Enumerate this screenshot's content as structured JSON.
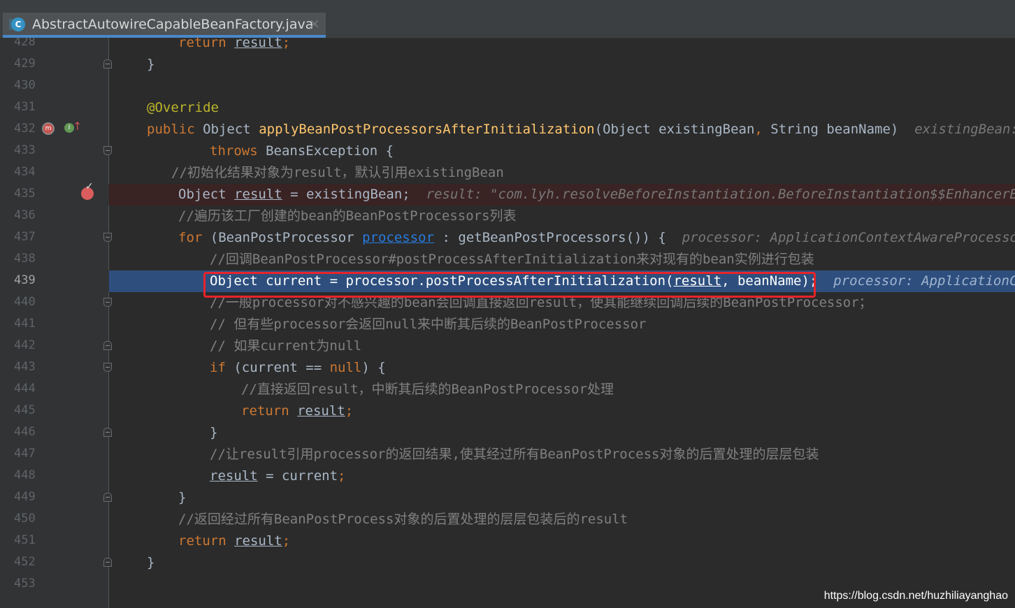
{
  "tab": {
    "icon_letter": "C",
    "title": "AbstractAutowireCapableBeanFactory.java",
    "close": "×"
  },
  "lines": {
    "428": {
      "num": "428"
    },
    "429": {
      "num": "429"
    },
    "430": {
      "num": "430"
    },
    "431": {
      "num": "431"
    },
    "432": {
      "num": "432"
    },
    "433": {
      "num": "433"
    },
    "434": {
      "num": "434"
    },
    "435": {
      "num": "435"
    },
    "436": {
      "num": "436"
    },
    "437": {
      "num": "437"
    },
    "438": {
      "num": "438"
    },
    "439": {
      "num": "439"
    },
    "440": {
      "num": "440"
    },
    "441": {
      "num": "441"
    },
    "442": {
      "num": "442"
    },
    "443": {
      "num": "443"
    },
    "444": {
      "num": "444"
    },
    "445": {
      "num": "445"
    },
    "446": {
      "num": "446"
    },
    "447": {
      "num": "447"
    },
    "448": {
      "num": "448"
    },
    "449": {
      "num": "449"
    },
    "450": {
      "num": "450"
    },
    "451": {
      "num": "451"
    },
    "452": {
      "num": "452"
    },
    "453": {
      "num": "453"
    }
  },
  "code": {
    "return_kw": "return",
    "result": "result",
    "semi": ";",
    "close_brace": "}",
    "annotation": "@Override",
    "public_kw": "public",
    "object_type": "Object",
    "method_name": "applyBeanPostProcessorsAfterInitialization",
    "params_1": "(Object existingBean",
    "comma": ",",
    "params_2": " String beanName)",
    "hint_432": "existingBean:",
    "throws_kw": "throws",
    "throws_rest": " BeansException {",
    "comment_434": "//初始化结果对象为result，默认引用existingBean",
    "l435_a": "Object ",
    "l435_b": " = existingBean;",
    "hint_435": "result: \"com.lyh.resolveBeforeInstantiation.BeforeInstantiation$$EnhancerBy",
    "comment_436": "//遍历该工厂创建的bean的BeanPostProcessors列表",
    "for_kw": "for",
    "l437_a": " (BeanPostProcessor ",
    "processor": "processor",
    "l437_b": " : getBeanPostProcessors()) {",
    "hint_437": "processor: ApplicationContextAwareProcessor@",
    "comment_438": "//回调BeanPostProcessor#postProcessAfterInitialization来对现有的bean实例进行包装",
    "l439_a": "Object current = processor.postProcessAfterInitialization(",
    "l439_b": ", beanName);",
    "hint_439": "processor: ApplicationCon",
    "comment_440": "//一般processor对不感兴趣的bean会回调直接返回result，使其能继续回调后续的BeanPostProcessor；",
    "comment_441": "// 但有些processor会返回null来中断其后续的BeanPostProcessor",
    "comment_442": "// 如果current为null",
    "if_kw": "if",
    "l443_a": " (current == ",
    "null_kw": "null",
    "l443_b": ") {",
    "comment_444": "//直接返回result，中断其后续的BeanPostProcessor处理",
    "comment_447": "//让result引用processor的返回结果,使其经过所有BeanPostProcess对象的后置处理的层层包装",
    "l448_b": " = current",
    "comment_450": "//返回经过所有BeanPostProcess对象的后置处理的层层包装后的result"
  },
  "gutter_icons": [
    "override-icon",
    "implemented-icon",
    "breakpoint-icon"
  ],
  "watermark": "https://blog.csdn.net/huzhiliayanghao",
  "colors": {
    "background": "#2b2b2b",
    "gutter": "#313335",
    "highlight": "#2e4f7e",
    "keyword": "#cc7832",
    "method": "#ffc66d",
    "comment": "#808080",
    "annotation": "#bbb529",
    "box": "#e8232a"
  }
}
